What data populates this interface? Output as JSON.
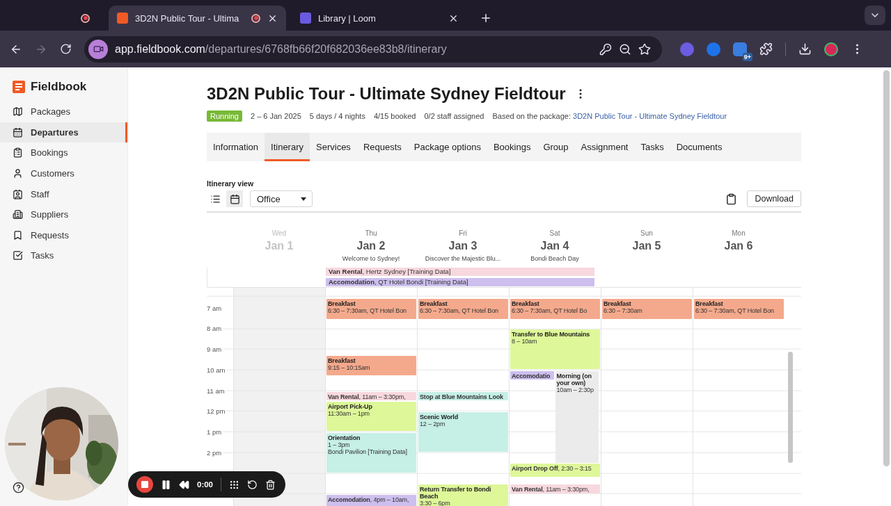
{
  "browser": {
    "tabs": [
      {
        "kind": "recording",
        "selected": false
      },
      {
        "kind": "page",
        "title": "3D2N Public Tour - Ultima",
        "recording": true,
        "selected": true
      },
      {
        "kind": "page",
        "title": "Library | Loom",
        "recording": false,
        "selected": false
      }
    ],
    "host": "app.fieldbook.com",
    "path": "/departures/6768fb66f20f682036ee83b8/itinerary",
    "extension_badge": "9+"
  },
  "sidebar": {
    "brand": "Fieldbook",
    "items": [
      {
        "label": "Packages",
        "selected": false
      },
      {
        "label": "Departures",
        "selected": true
      },
      {
        "label": "Bookings",
        "selected": false
      },
      {
        "label": "Customers",
        "selected": false
      },
      {
        "label": "Staff",
        "selected": false
      },
      {
        "label": "Suppliers",
        "selected": false
      },
      {
        "label": "Requests",
        "selected": false
      },
      {
        "label": "Tasks",
        "selected": false
      }
    ]
  },
  "departure": {
    "title": "3D2N Public Tour - Ultimate Sydney Fieldtour",
    "status": "Running",
    "meta": [
      "2 – 6 Jan 2025",
      "5 days / 4 nights",
      "4/15 booked",
      "0/2 staff assigned"
    ],
    "package_label": "Based on the package:",
    "package_link": "3D2N Public Tour - Ultimate Sydney Fieldtour"
  },
  "tabs": [
    {
      "label": "Information",
      "selected": false
    },
    {
      "label": "Itinerary",
      "selected": true
    },
    {
      "label": "Services",
      "selected": false
    },
    {
      "label": "Requests",
      "selected": false
    },
    {
      "label": "Package options",
      "selected": false
    },
    {
      "label": "Bookings",
      "selected": false
    },
    {
      "label": "Group",
      "selected": false
    },
    {
      "label": "Assignment",
      "selected": false
    },
    {
      "label": "Tasks",
      "selected": false
    },
    {
      "label": "Documents",
      "selected": false
    }
  ],
  "itinerary_view": {
    "label": "Itinerary view",
    "views": [
      {
        "kind": "list",
        "selected": false
      },
      {
        "kind": "calendar",
        "selected": true
      }
    ],
    "select": "Office",
    "download": "Download"
  },
  "calendar": {
    "hours": [
      "7 am",
      "8 am",
      "9 am",
      "10 am",
      "11 am",
      "12 pm",
      "1 pm",
      "2 pm"
    ],
    "all_day": [
      {
        "text": "**Van Rental**, Hertz Sydney [Training Data]",
        "color": "#f7d8de"
      },
      {
        "text": "**Accomodation**, QT Hotel Bondi [Training Data]",
        "color": "#cdbfee"
      }
    ],
    "days": [
      {
        "weekday": "Wed",
        "date": "Jan 1",
        "past": true
      },
      {
        "weekday": "Thu",
        "date": "Jan 2",
        "subtitle": "Welcome to Sydney!",
        "past": false,
        "events": [
          {
            "kind": "block",
            "title": "Breakfast",
            "lines": [
              "6:30 – 7:30am, QT Hotel Bon"
            ],
            "color": "#f4a98c"
          },
          {
            "kind": "block",
            "title": "Breakfast",
            "lines": [
              "9:15 – 10:15am"
            ],
            "color": "#f4a98c"
          },
          {
            "kind": "inline",
            "text": "**Van Rental**, 11am – 3:30pm,",
            "color": "#f7d8de"
          },
          {
            "kind": "block",
            "title": "Airport Pick-Up",
            "lines": [
              "11:30am – 1pm"
            ],
            "color": "#def799"
          },
          {
            "kind": "block",
            "title": "Orientation",
            "lines": [
              "1 – 3pm",
              "Bondi Pavilion [Training Data]"
            ],
            "color": "#c6efe6"
          },
          {
            "kind": "inline",
            "text": "**Accomodation**, 4pm – 10am,",
            "color": "#cdbfee"
          }
        ]
      },
      {
        "weekday": "Fri",
        "date": "Jan 3",
        "subtitle": "Discover the Majestic Blu...",
        "past": false,
        "events": [
          {
            "kind": "block",
            "title": "Breakfast",
            "lines": [
              "6:30 – 7:30am, QT Hotel Bon"
            ],
            "color": "#f4a98c"
          },
          {
            "kind": "inline",
            "text": "**Stop at Blue Mountains Look**",
            "color": "#c6efe6"
          },
          {
            "kind": "block",
            "title": "Scenic World",
            "lines": [
              "12 – 2pm"
            ],
            "color": "#c6efe6"
          },
          {
            "kind": "block",
            "title": "Return Transfer to Bondi Beach",
            "lines": [
              "3:30 – 6pm"
            ],
            "color": "#def799"
          }
        ]
      },
      {
        "weekday": "Sat",
        "date": "Jan 4",
        "subtitle": "Bondi Beach Day",
        "past": false,
        "events": [
          {
            "kind": "block",
            "title": "Breakfast",
            "lines": [
              "6:30 – 7:30am, QT Hotel Bo"
            ],
            "color": "#f4a98c"
          },
          {
            "kind": "block",
            "title": "Transfer to Blue Mountains",
            "lines": [
              "8 – 10am"
            ],
            "color": "#def799"
          },
          {
            "kind": "inline",
            "text": "**Accomodatio**",
            "color": "#cdbfee"
          },
          {
            "kind": "block",
            "title": "Morning (on your own)",
            "lines": [
              "10am – 2:30p"
            ],
            "color": "#ebebeb"
          },
          {
            "kind": "inline",
            "text": "**Airport Drop Off**, 2:30 – 3:15",
            "color": "#def799"
          },
          {
            "kind": "inline",
            "text": "**Van Rental**, 11am – 3:30pm,",
            "color": "#f7d8de"
          }
        ]
      },
      {
        "weekday": "Sun",
        "date": "Jan 5",
        "past": false,
        "events": [
          {
            "kind": "block",
            "title": "Breakfast",
            "lines": [
              "6:30 – 7:30am"
            ],
            "color": "#f4a98c"
          }
        ]
      },
      {
        "weekday": "Mon",
        "date": "Jan 6",
        "past": false,
        "events": [
          {
            "kind": "block",
            "title": "Breakfast",
            "lines": [
              "6:30 – 7:30am, QT Hotel Bon"
            ],
            "color": "#f4a98c"
          }
        ]
      }
    ]
  },
  "recorder": {
    "time": "0:00"
  }
}
